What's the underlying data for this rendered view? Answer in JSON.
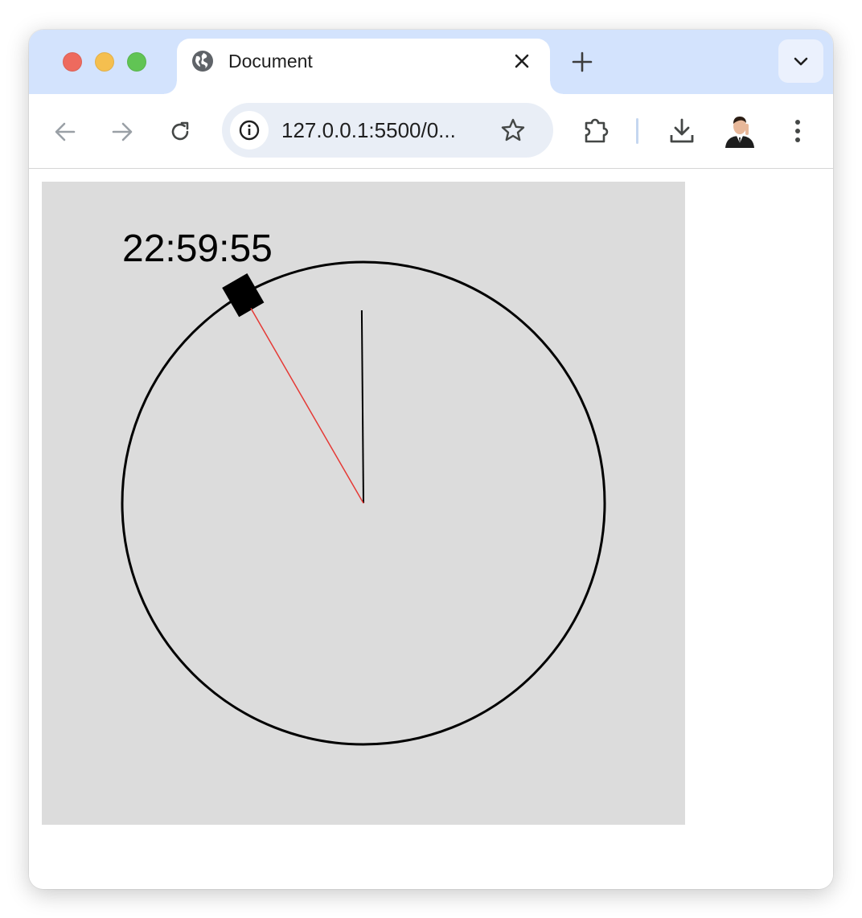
{
  "browser": {
    "tab": {
      "title": "Document",
      "favicon": "globe-icon"
    },
    "address_bar": {
      "url": "127.0.0.1:5500/0..."
    },
    "icons": {
      "back": "arrow-left-icon",
      "forward": "arrow-right-icon",
      "reload": "reload-icon",
      "site_info": "info-icon",
      "bookmark": "star-icon",
      "extensions": "puzzle-icon",
      "downloads": "download-icon",
      "profile": "avatar",
      "menu": "kebab-menu-icon",
      "tab_close": "close-icon",
      "new_tab": "plus-icon",
      "tab_search": "chevron-down-icon"
    },
    "colors": {
      "tabstrip": "#d3e3fd",
      "omnibox": "#e9eef6",
      "traffic_red": "#ee6a5e",
      "traffic_yellow": "#f5bf4f",
      "traffic_green": "#61c454"
    }
  },
  "page": {
    "canvas_background": "#dcdcdc",
    "digital_clock": "22:59:55",
    "clock": {
      "hours": 22,
      "minutes": 59,
      "seconds": 55,
      "hand_color": "#000000",
      "second_hand_color": "#e53935"
    }
  }
}
